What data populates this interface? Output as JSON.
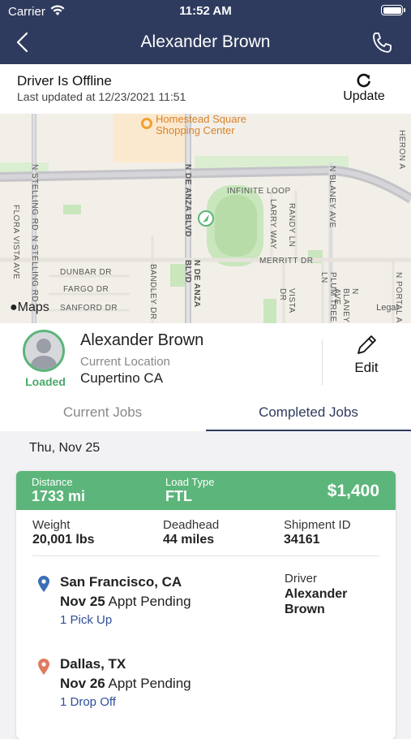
{
  "status_bar": {
    "carrier": "Carrier",
    "time": "11:52 AM"
  },
  "nav": {
    "title": "Alexander Brown"
  },
  "offline": {
    "title": "Driver Is Offline",
    "last_updated": "Last updated at 12/23/2021 11:51",
    "update_label": "Update"
  },
  "map": {
    "poi": "Homestead Square\nShopping Center",
    "streets": {
      "stelling1": "N STELLING RD",
      "stelling2": "N STELLING RD",
      "deanza": "N DE ANZA BLVD",
      "deanza2": "N DE ANZA BLVD",
      "blaney": "N BLANEY AVE",
      "blaney2": "N BLANEY AVE",
      "flora": "FLORA VISTA AVE",
      "dunbar": "DUNBAR DR",
      "fargo": "FARGO DR",
      "sanford": "SANFORD DR",
      "bandley": "BANDLEY DR",
      "infinite": "INFINITE LOOP",
      "larry": "LARRY WAY",
      "randy": "RANDY LN",
      "merritt": "MERRITT DR",
      "vista": "VISTA DR",
      "plum": "PLUM TREE LN",
      "portal": "N PORTAL A",
      "heron": "HERON A"
    },
    "maps_logo": "Maps",
    "legal": "Legal"
  },
  "driver": {
    "name": "Alexander Brown",
    "status": "Loaded",
    "location_label": "Current Location",
    "location": "Cupertino CA",
    "edit_label": "Edit"
  },
  "tabs": [
    {
      "label": "Current Jobs",
      "active": false
    },
    {
      "label": "Completed Jobs",
      "active": true
    }
  ],
  "date_heading": "Thu, Nov 25",
  "job": {
    "distance_label": "Distance",
    "distance": "1733 mi",
    "load_type_label": "Load Type",
    "load_type": "FTL",
    "price": "$1,400",
    "weight_label": "Weight",
    "weight": "20,001 lbs",
    "deadhead_label": "Deadhead",
    "deadhead": "44 miles",
    "shipment_label": "Shipment ID",
    "shipment_id": "34161",
    "driver_label": "Driver",
    "driver_name": "Alexander Brown",
    "pickup": {
      "city": "San Francisco, CA",
      "date": "Nov 25",
      "status": " Appt Pending",
      "link": "1 Pick Up"
    },
    "dropoff": {
      "city": "Dallas, TX",
      "date": "Nov 26",
      "status": " Appt Pending",
      "link": "1 Drop Off"
    }
  },
  "colors": {
    "nav": "#2f3b5e",
    "accent_green": "#5cb57a",
    "link_blue": "#2f4f9a",
    "pickup_pin": "#3a6fb5",
    "dropoff_pin": "#e07a5f"
  }
}
